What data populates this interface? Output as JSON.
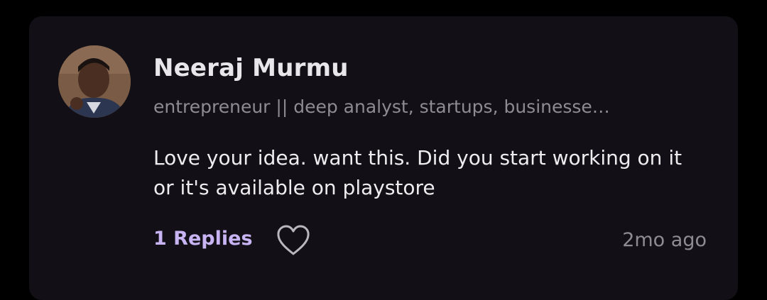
{
  "comment": {
    "author_name": "Neeraj Murmu",
    "author_headline": "entrepreneur || deep analyst, startups, businesse…",
    "text": "Love your idea. want this. Did you start working on it or it's available on playstore",
    "replies_label": "1 Replies",
    "timestamp": "2mo ago",
    "avatar_icon": "user-photo",
    "like_icon": "heart-outline-icon"
  },
  "colors": {
    "background": "#000000",
    "card": "#121016",
    "accent": "#c8b4f2",
    "muted_text": "#8e8b93",
    "primary_text": "#eeecef"
  }
}
